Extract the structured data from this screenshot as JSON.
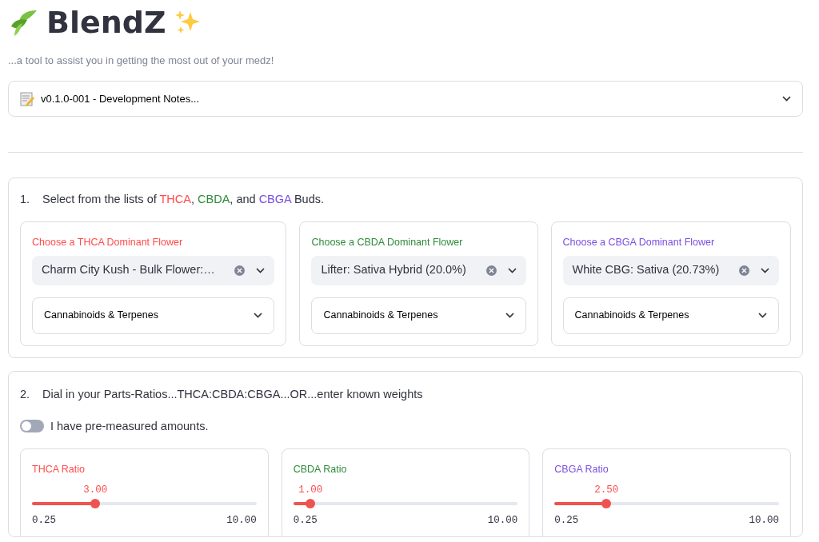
{
  "header": {
    "title": "BlendZ",
    "subtitle": "...a tool to assist you in getting the most out of your medz!"
  },
  "notes_expander": {
    "label": "v0.1.0-001 - Development Notes...",
    "expanded": false
  },
  "section_1": {
    "number": "1.",
    "heading_parts": [
      {
        "text": "Select from the lists of "
      },
      {
        "text": "THCA",
        "color": "#ff4b4b"
      },
      {
        "text": ", "
      },
      {
        "text": "CBDA",
        "color": "#2e8b3a"
      },
      {
        "text": ", and "
      },
      {
        "text": "CBGA",
        "color": "#7a4ee0"
      },
      {
        "text": " Buds."
      }
    ],
    "pickers": [
      {
        "label": "Choose a THCA Dominant Flower",
        "color": "#ff4b4b",
        "value": "Charm City Kush - Bulk Flower:…",
        "expander": "Cannabinoids & Terpenes"
      },
      {
        "label": "Choose a CBDA Dominant Flower",
        "color": "#2e8b3a",
        "value": "Lifter: Sativa Hybrid (20.0%)",
        "expander": "Cannabinoids & Terpenes"
      },
      {
        "label": "Choose a CBGA Dominant Flower",
        "color": "#7a4ee0",
        "value": "White CBG: Sativa (20.73%)",
        "expander": "Cannabinoids & Terpenes"
      }
    ]
  },
  "section_2": {
    "number": "2.",
    "heading": "Dial in your Parts-Ratios...THCA:CBDA:CBGA...OR...enter known weights",
    "toggle": {
      "label": "I have pre-measured amounts.",
      "on": false
    },
    "sliders": [
      {
        "label": "THCA Ratio",
        "color": "#ff4b4b",
        "reading": "3.00",
        "level": 0.282,
        "min": "0.25",
        "max": "10.00"
      },
      {
        "label": "CBDA Ratio",
        "color": "#2e8b3a",
        "reading": "1.00",
        "level": 0.077,
        "min": "0.25",
        "max": "10.00"
      },
      {
        "label": "CBGA Ratio",
        "color": "#7a4ee0",
        "reading": "2.50",
        "level": 0.231,
        "min": "0.25",
        "max": "10.00"
      }
    ]
  }
}
